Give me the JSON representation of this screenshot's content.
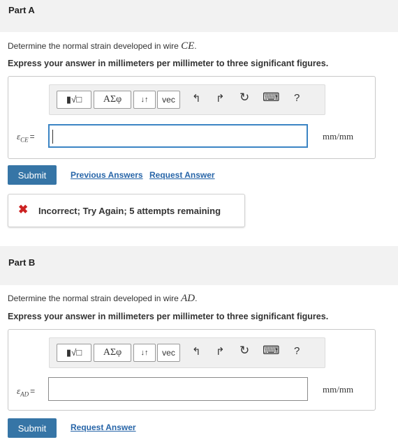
{
  "part_a": {
    "header": "Part A",
    "question_prefix": "Determine the normal strain developed in wire ",
    "question_var": "CE",
    "question_suffix": ".",
    "instruction": "Express your answer in millimeters per millimeter to three significant figures.",
    "toolbar": {
      "templates_label": "▮√□",
      "greek_label": "ΑΣφ",
      "arrows_label": "↓↑",
      "vec_label": "vec",
      "undo_icon": "↰",
      "redo_icon": "↱",
      "reset_icon": "↻",
      "keyboard_icon": "⌨",
      "help_label": "?"
    },
    "var_symbol": "ε",
    "var_sub": "CE",
    "equals": "=",
    "input_value": "",
    "units": "mm/mm",
    "submit_label": "Submit",
    "previous_answers_label": "Previous Answers",
    "request_answer_label": "Request Answer",
    "feedback_icon": "✖",
    "feedback_text": "Incorrect; Try Again; 5 attempts remaining"
  },
  "part_b": {
    "header": "Part B",
    "question_prefix": "Determine the normal strain developed in wire ",
    "question_var": "AD",
    "question_suffix": ".",
    "instruction": "Express your answer in millimeters per millimeter to three significant figures.",
    "toolbar": {
      "templates_label": "▮√□",
      "greek_label": "ΑΣφ",
      "arrows_label": "↓↑",
      "vec_label": "vec",
      "undo_icon": "↰",
      "redo_icon": "↱",
      "reset_icon": "↻",
      "keyboard_icon": "⌨",
      "help_label": "?"
    },
    "var_symbol": "ε",
    "var_sub": "AD",
    "equals": "=",
    "input_value": "",
    "units": "mm/mm",
    "submit_label": "Submit",
    "request_answer_label": "Request Answer"
  }
}
